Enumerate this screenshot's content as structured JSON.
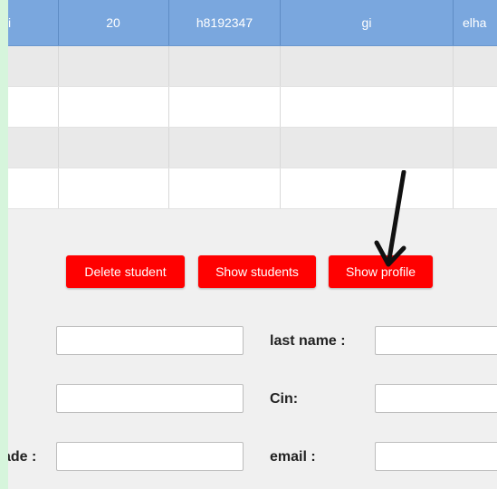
{
  "table": {
    "rows": [
      {
        "type": "selected",
        "cells": [
          "i",
          "20",
          "h8192347",
          "gi",
          "elha"
        ]
      },
      {
        "type": "gray",
        "cells": [
          "",
          "",
          "",
          "",
          ""
        ]
      },
      {
        "type": "white",
        "cells": [
          "",
          "",
          "",
          "",
          ""
        ]
      },
      {
        "type": "gray",
        "cells": [
          "",
          "",
          "",
          "",
          ""
        ]
      },
      {
        "type": "white",
        "cells": [
          "",
          "",
          "",
          "",
          ""
        ]
      }
    ]
  },
  "buttons": {
    "delete_label": "Delete student",
    "show_students_label": "Show students",
    "show_profile_label": "Show profile"
  },
  "form": {
    "last_name_label": "last name :",
    "cin_label": "Cin:",
    "email_label": "email :",
    "grade_label_partial": "ade :"
  },
  "colors": {
    "button_red": "#ff0000",
    "selected_row": "#7aa7de",
    "page_margin": "#d6f5dc"
  },
  "annotation": {
    "icon": "down-arrow-icon"
  }
}
